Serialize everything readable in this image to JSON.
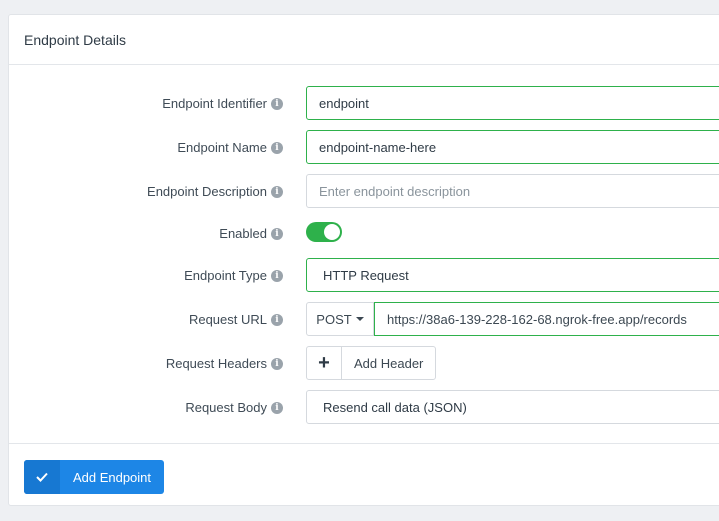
{
  "panel": {
    "title": "Endpoint Details"
  },
  "fields": {
    "identifier": {
      "label": "Endpoint Identifier",
      "value": "endpoint"
    },
    "name": {
      "label": "Endpoint Name",
      "value": "endpoint-name-here"
    },
    "description": {
      "label": "Endpoint Description",
      "placeholder": "Enter endpoint description"
    },
    "enabled": {
      "label": "Enabled",
      "state": true
    },
    "type": {
      "label": "Endpoint Type",
      "value": "HTTP Request"
    },
    "request_url": {
      "label": "Request URL",
      "method": "POST",
      "value": "https://38a6-139-228-162-68.ngrok-free.app/records"
    },
    "request_headers": {
      "label": "Request Headers",
      "button_label": "Add Header"
    },
    "request_body": {
      "label": "Request Body",
      "value": "Resend call data (JSON)"
    }
  },
  "footer": {
    "submit_label": "Add Endpoint"
  },
  "colors": {
    "accent": "#1d86e6",
    "valid": "#2eb14b"
  }
}
